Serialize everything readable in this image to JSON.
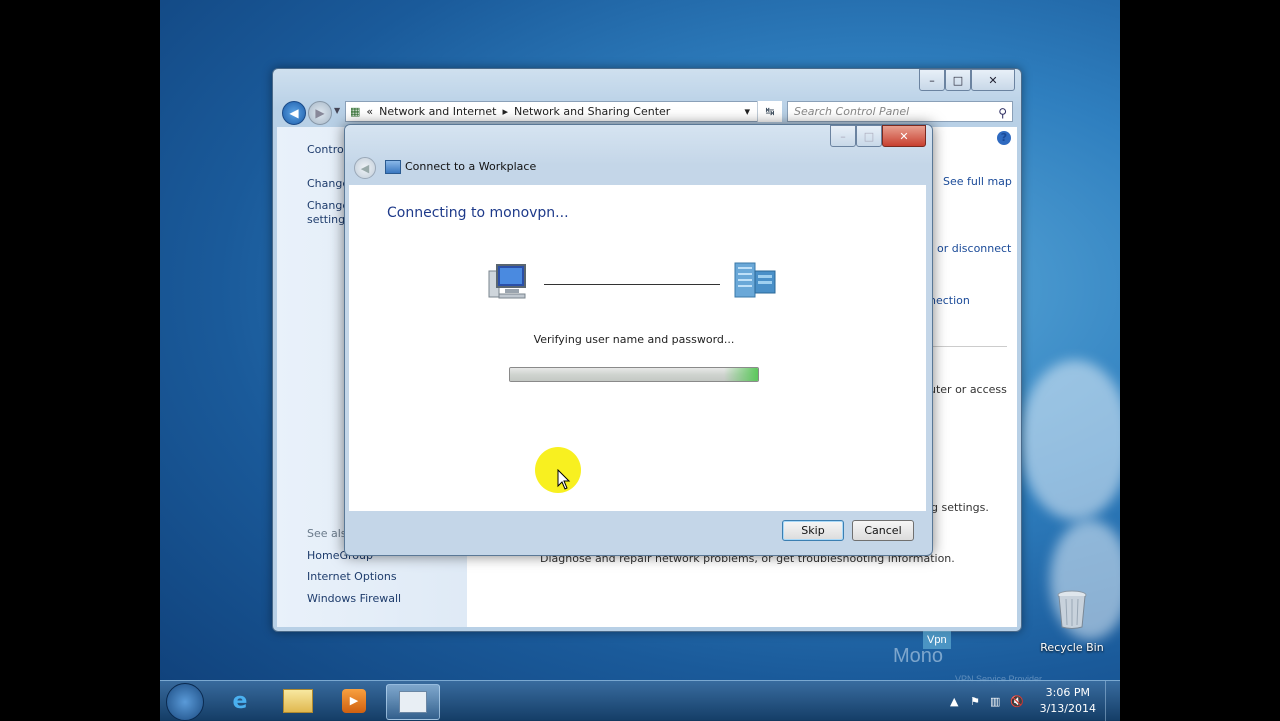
{
  "window": {
    "minimize_icon": "minimize-icon",
    "maximize_icon": "maximize-icon",
    "close_icon": "close-icon"
  },
  "address_bar": {
    "prefix": "«",
    "crumbs": [
      "Network and Internet",
      "Network and Sharing Center"
    ],
    "separator": "▸",
    "dropdown": "▾",
    "refresh": "↹"
  },
  "search": {
    "placeholder": "Search Control Panel"
  },
  "sidebar": {
    "items": [
      "Control Panel Home",
      "Change adapter settings",
      "Change advanced sharing settings"
    ],
    "item0_visible": "Control",
    "item1_visible": "Change",
    "item2_visible_line1": "Change",
    "item2_visible_line2": "settings",
    "see_also": "See also",
    "see_also_visible": "See als",
    "links": [
      "HomeGroup",
      "Internet Options",
      "Windows Firewall"
    ]
  },
  "main": {
    "see_full_map": "See full map",
    "fragment_disconnect": "or disconnect",
    "fragment_connection": "nection",
    "fragment_access": "uter or access",
    "fragment_settings": "g settings.",
    "troubleshoot": "Diagnose and repair network problems, or get troubleshooting information.",
    "help": "?"
  },
  "dialog": {
    "title": "Connect to a Workplace",
    "heading": "Connecting to monovpn...",
    "status": "Verifying user name and password...",
    "progress": 1.0,
    "skip_label": "Skip",
    "cancel_label": "Cancel",
    "back_icon": "back-arrow-icon"
  },
  "desktop": {
    "recycle_bin": "Recycle Bin",
    "watermark_brand": "Mono",
    "watermark_badge": "Vpn",
    "watermark_tagline": "VPN Service Provider"
  },
  "taskbar": {
    "time": "3:06 PM",
    "date": "3/13/2014",
    "apps": [
      "start-orb-icon",
      "internet-explorer-icon",
      "file-explorer-icon",
      "media-player-icon",
      "control-panel-icon"
    ]
  },
  "colors": {
    "accent": "#1e3a8a",
    "link": "#1a4a98",
    "progress_green": "#5cc85c"
  }
}
